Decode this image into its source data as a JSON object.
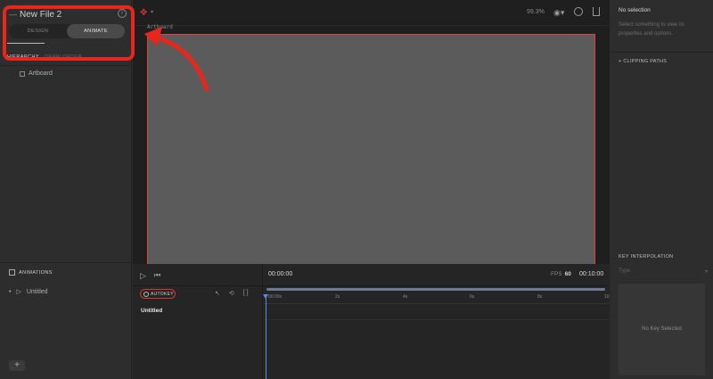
{
  "left_panel": {
    "file_title": "New File 2",
    "modes": [
      "DESIGN",
      "ANIMATE"
    ],
    "active_mode": "ANIMATE",
    "hierarchy_label": "HIERARCHY",
    "hierarchy_secondary": "DRAW ORDER",
    "tree_items": [
      "Artboard"
    ],
    "animations_label": "ANIMATIONS",
    "animations": [
      "Untitled"
    ],
    "add_label": "+"
  },
  "toolbar": {
    "zoom": "99.3%"
  },
  "canvas": {
    "artboard_label": "Artboard"
  },
  "timeline": {
    "autokey_label": "AUTOKEY",
    "animation_name": "Untitled",
    "current_time": "00:00:00",
    "fps_label": "FPS",
    "fps_value": "60",
    "duration": "00:10:00",
    "ticks": [
      "00:00s",
      "2s",
      "4s",
      "6s",
      "8s",
      "10"
    ]
  },
  "right_panel": {
    "title": "No selection",
    "help": "Select something to view its properties and options.",
    "clipping_label": "CLIPPING PATHS",
    "key_interp_label": "KEY INTERPOLATION",
    "type_label": "Type",
    "no_key": "No Key Selected"
  },
  "colors": {
    "accent_red": "#e8261c",
    "playhead_blue": "#5a8ed8",
    "artboard_fill": "#5b5b5b"
  }
}
